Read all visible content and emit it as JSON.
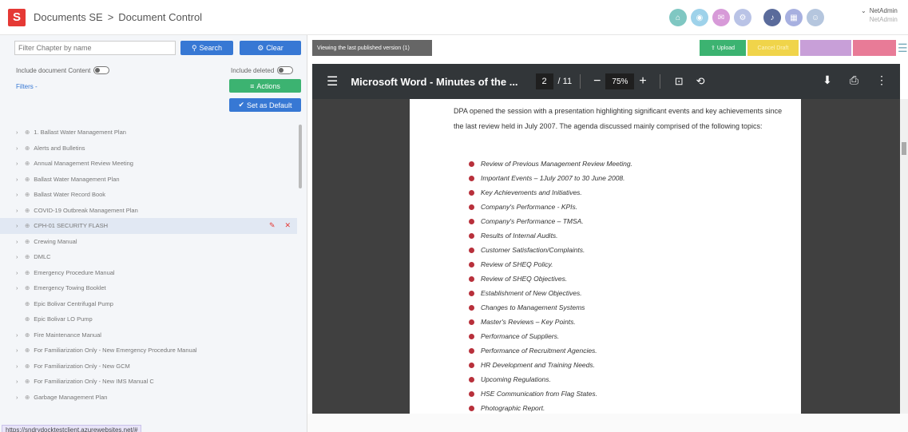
{
  "app": {
    "logo_letter": "S",
    "breadcrumb": [
      "Documents SE",
      ">",
      "Document Control"
    ]
  },
  "user": {
    "name": "NetAdmin",
    "role": "NetAdmin"
  },
  "left": {
    "filter_placeholder": "Filter Chapter by name",
    "search_label": "Search",
    "clear_label": "Clear",
    "include_content_label": "Include document Content",
    "include_deleted_label": "Include deleted",
    "filters_label": "Filters -",
    "actions_label": "Actions",
    "set_default_label": "Set as Default",
    "tree": [
      {
        "label": "1. Ballast Water Management Plan",
        "expand": true
      },
      {
        "label": "Alerts and Bulletins",
        "expand": true
      },
      {
        "label": "Annual Management Review Meeting",
        "expand": true
      },
      {
        "label": "Ballast Water Management Plan",
        "expand": true
      },
      {
        "label": "Ballast Water Record Book",
        "expand": true
      },
      {
        "label": "COVID-19 Outbreak Management Plan",
        "expand": true
      },
      {
        "label": "CPH-01 SECURITY FLASH",
        "expand": true,
        "selected": true
      },
      {
        "label": "Crewing Manual",
        "expand": true
      },
      {
        "label": "DMLC",
        "expand": true
      },
      {
        "label": "Emergency Procedure Manual",
        "expand": true
      },
      {
        "label": "Emergency Towing Booklet",
        "expand": true
      },
      {
        "label": "Epic Bolivar Centrifugal Pump",
        "expand": false
      },
      {
        "label": "Epic Bolivar LO Pump",
        "expand": false
      },
      {
        "label": "Fire Maintenance Manual",
        "expand": true
      },
      {
        "label": "For Familiarization Only - New Emergency Procedure Manual",
        "expand": true
      },
      {
        "label": "For Familiarization Only - New GCM",
        "expand": true
      },
      {
        "label": "For Familiarization Only - New IMS Manual C",
        "expand": true
      },
      {
        "label": "Garbage Management Plan",
        "expand": true
      }
    ],
    "status_url": "https://sndrydocktestclient.azurewebsites.net/#"
  },
  "toolbar_right": {
    "viewing_label": "Viewing the last published version (1)",
    "upload_label": "Upload",
    "cancel_draft_label": "Cancel Draft",
    "btn3_label": "",
    "btn4_label": "",
    "colors": {
      "upload": "#3cb371",
      "cancel": "#f0d44a",
      "b3": "#c89fd8",
      "b4": "#e87b97"
    }
  },
  "viewer": {
    "title": "Microsoft Word - Minutes of the ...",
    "page_current": "2",
    "page_total": "/ 11",
    "zoom": "75%",
    "paragraph": "DPA opened the session with a presentation highlighting significant events and key achievements since the last review held in July 2007.  The agenda discussed mainly comprised of the following topics:",
    "bullets": [
      "Review of Previous Management Review Meeting.",
      "Important Events – 1July 2007 to 30 June 2008.",
      "Key Achievements and Initiatives.",
      "Company's Performance - KPIs.",
      "Company's Performance – TMSA.",
      "Results of Internal Audits.",
      "Customer Satisfaction/Complaints.",
      "Review of SHEQ Policy.",
      "Review of SHEQ Objectives.",
      "Establishment of New Objectives.",
      "Changes to Management Systems",
      "Master's Reviews – Key Points.",
      "Performance of Suppliers.",
      "Performance of Recruitment Agencies.",
      "HR Development and Training Needs.",
      "Upcoming Regulations.",
      "HSE Communication from Flag States.",
      "Photographic Report."
    ]
  },
  "icons": {
    "top": [
      {
        "name": "home-icon",
        "color": "#7fc7c2",
        "glyph": "⌂"
      },
      {
        "name": "eye-icon",
        "color": "#9ed2ea",
        "glyph": "◉"
      },
      {
        "name": "mail-icon",
        "color": "#d79ad8",
        "glyph": "✉"
      },
      {
        "name": "settings-icon",
        "color": "#b9c3e6",
        "glyph": "⚙"
      },
      {
        "name": "bell-icon",
        "color": "#5a6b9b",
        "glyph": "♪"
      },
      {
        "name": "grid-icon",
        "color": "#a7b0e0",
        "glyph": "▦"
      },
      {
        "name": "avatar-icon",
        "color": "#b5c6de",
        "glyph": "☺"
      }
    ]
  }
}
